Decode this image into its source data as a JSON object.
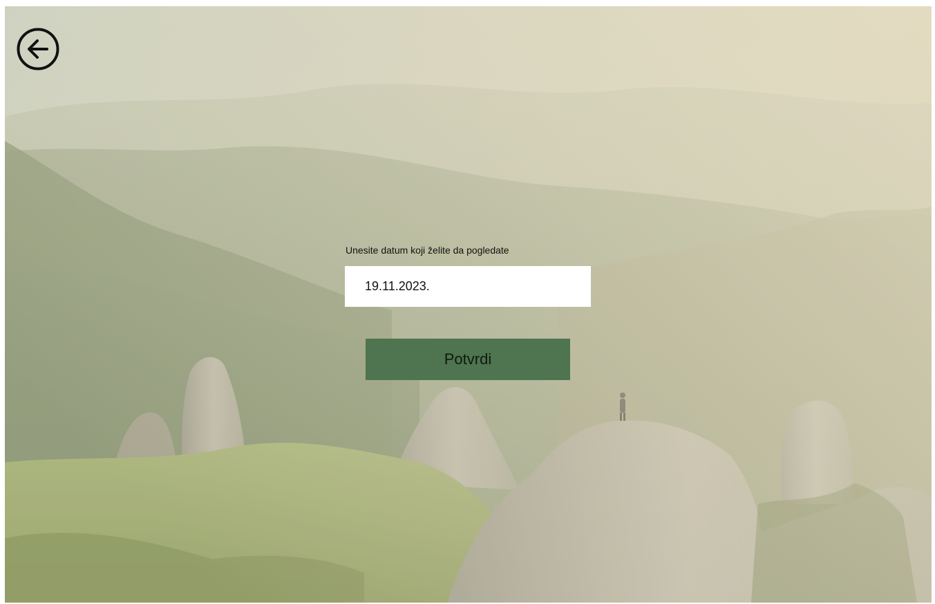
{
  "navigation": {
    "back_icon": "arrow-left-circle-icon"
  },
  "form": {
    "label": "Unesite datum koji želite da pogledate",
    "date_value": "19.11.2023.",
    "confirm_label": "Potvrdi"
  },
  "colors": {
    "button_bg": "#4f7450",
    "input_bg": "#ffffff",
    "text": "#111111"
  }
}
